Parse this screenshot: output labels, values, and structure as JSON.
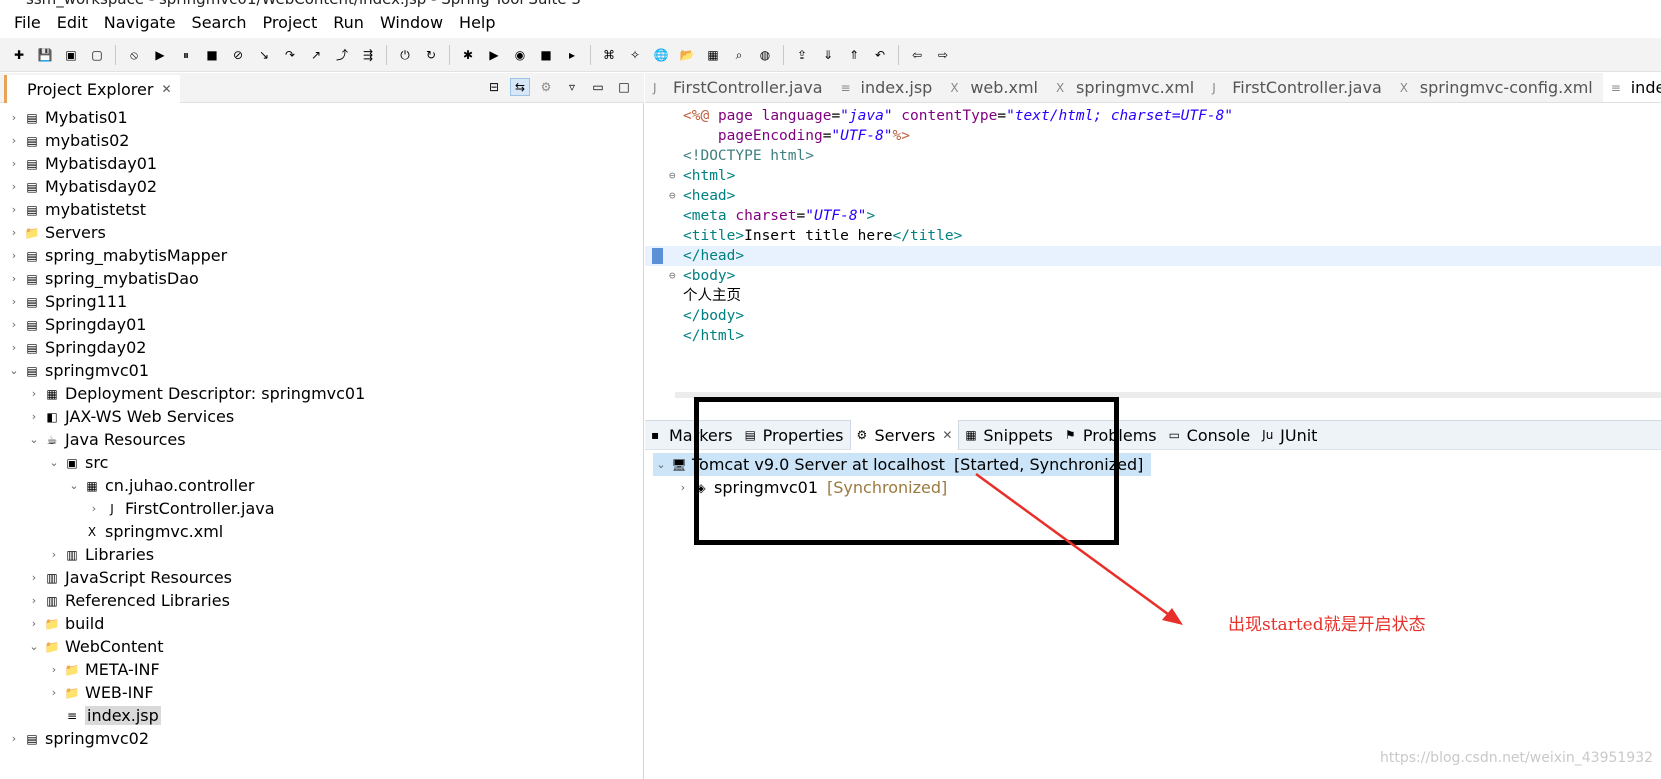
{
  "window": {
    "title": "ssm_workspace - springmvc01/WebContent/index.jsp - Spring Tool Suite 3"
  },
  "menubar": [
    "File",
    "Edit",
    "Navigate",
    "Search",
    "Project",
    "Run",
    "Window",
    "Help"
  ],
  "toolbar": {
    "icons": [
      "new-icon",
      "save-icon",
      "save-all-icon",
      "terminal-icon",
      "skip-breakpoints-icon",
      "resume-icon",
      "suspend-icon",
      "terminate-icon",
      "disconnect-icon",
      "step-into-icon",
      "step-over-icon",
      "step-return-icon",
      "drop-to-frame-icon",
      "use-step-filters-icon",
      "start-server-icon",
      "refresh-icon",
      "debug-icon",
      "run-icon",
      "coverage-icon",
      "stop-icon",
      "external-tools-icon",
      "open-type-icon",
      "new-spring-icon",
      "web-browser-icon",
      "open-folder-icon",
      "open-task-icon",
      "search-icon",
      "globe-icon",
      "deploy-icon",
      "next-annotation-icon",
      "previous-annotation-icon",
      "last-edit-icon",
      "back-icon",
      "forward-icon"
    ]
  },
  "explorer": {
    "title": "Project Explorer",
    "tree": [
      {
        "label": "Mybatis01",
        "icon": "project-icon",
        "depth": 0,
        "arrow": "collapsed"
      },
      {
        "label": "mybatis02",
        "icon": "project-icon",
        "depth": 0,
        "arrow": "collapsed"
      },
      {
        "label": "Mybatisday01",
        "icon": "project-icon",
        "depth": 0,
        "arrow": "collapsed"
      },
      {
        "label": "Mybatisday02",
        "icon": "project-icon",
        "depth": 0,
        "arrow": "collapsed"
      },
      {
        "label": "mybatistetst",
        "icon": "project-icon",
        "depth": 0,
        "arrow": "collapsed"
      },
      {
        "label": "Servers",
        "icon": "folder-icon",
        "depth": 0,
        "arrow": "collapsed"
      },
      {
        "label": "spring_mabytisMapper",
        "icon": "project-icon",
        "depth": 0,
        "arrow": "collapsed"
      },
      {
        "label": "spring_mybatisDao",
        "icon": "project-icon",
        "depth": 0,
        "arrow": "collapsed"
      },
      {
        "label": "Spring111",
        "icon": "project-icon",
        "depth": 0,
        "arrow": "collapsed"
      },
      {
        "label": "Springday01",
        "icon": "project-icon",
        "depth": 0,
        "arrow": "collapsed"
      },
      {
        "label": "Springday02",
        "icon": "project-icon",
        "depth": 0,
        "arrow": "collapsed"
      },
      {
        "label": "springmvc01",
        "icon": "project-icon",
        "depth": 0,
        "arrow": "expanded"
      },
      {
        "label": "Deployment Descriptor: springmvc01",
        "icon": "descriptor-icon",
        "depth": 1,
        "arrow": "collapsed"
      },
      {
        "label": "JAX-WS Web Services",
        "icon": "web-services-icon",
        "depth": 1,
        "arrow": "collapsed"
      },
      {
        "label": "Java Resources",
        "icon": "java-resources-icon",
        "depth": 1,
        "arrow": "expanded"
      },
      {
        "label": "src",
        "icon": "source-folder-icon",
        "depth": 2,
        "arrow": "expanded"
      },
      {
        "label": "cn.juhao.controller",
        "icon": "package-icon",
        "depth": 3,
        "arrow": "expanded"
      },
      {
        "label": "FirstController.java",
        "icon": "java-file-icon",
        "depth": 4,
        "arrow": "collapsed"
      },
      {
        "label": "springmvc.xml",
        "icon": "xml-file-icon",
        "depth": 3,
        "arrow": "none"
      },
      {
        "label": "Libraries",
        "icon": "library-icon",
        "depth": 2,
        "arrow": "collapsed"
      },
      {
        "label": "JavaScript Resources",
        "icon": "library-icon",
        "depth": 1,
        "arrow": "collapsed"
      },
      {
        "label": "Referenced Libraries",
        "icon": "library-icon",
        "depth": 1,
        "arrow": "collapsed"
      },
      {
        "label": "build",
        "icon": "folder-icon",
        "depth": 1,
        "arrow": "collapsed"
      },
      {
        "label": "WebContent",
        "icon": "folder-icon",
        "depth": 1,
        "arrow": "expanded"
      },
      {
        "label": "META-INF",
        "icon": "folder-icon",
        "depth": 2,
        "arrow": "collapsed"
      },
      {
        "label": "WEB-INF",
        "icon": "folder-icon",
        "depth": 2,
        "arrow": "collapsed"
      },
      {
        "label": "index.jsp",
        "icon": "jsp-file-icon",
        "depth": 2,
        "arrow": "none",
        "selected": true
      },
      {
        "label": "springmvc02",
        "icon": "project-icon",
        "depth": 0,
        "arrow": "collapsed"
      }
    ]
  },
  "editor": {
    "tabs": [
      {
        "label": "FirstController.java",
        "icon": "java-file-icon"
      },
      {
        "label": "index.jsp",
        "icon": "jsp-file-icon"
      },
      {
        "label": "web.xml",
        "icon": "xml-file-icon"
      },
      {
        "label": "springmvc.xml",
        "icon": "xml-file-icon"
      },
      {
        "label": "FirstController.java",
        "icon": "java-file-icon"
      },
      {
        "label": "springmvc-config.xml",
        "icon": "xml-file-icon"
      },
      {
        "label": "inde",
        "icon": "jsp-file-icon",
        "active": true
      }
    ],
    "body_text": "个人主页"
  },
  "bottom_panel": {
    "tabs": [
      {
        "label": "Markers",
        "icon": "markers-icon"
      },
      {
        "label": "Properties",
        "icon": "properties-icon"
      },
      {
        "label": "Servers",
        "icon": "servers-icon",
        "active": true
      },
      {
        "label": "Snippets",
        "icon": "snippets-icon"
      },
      {
        "label": "Problems",
        "icon": "problems-icon"
      },
      {
        "label": "Console",
        "icon": "console-icon"
      },
      {
        "label": "JUnit",
        "icon": "junit-icon"
      }
    ],
    "server": {
      "name": "Tomcat v9.0 Server at localhost",
      "status": "[Started, Synchronized]"
    },
    "module": {
      "name": "springmvc01",
      "status": "[Synchronized]"
    }
  },
  "annotation": {
    "text": "出现started就是开启状态",
    "color": "#e8302a"
  },
  "watermark": "https://blog.csdn.net/weixin_43951932",
  "colors": {
    "accent": "#e8a25a",
    "selection": "#cce4f7",
    "line_highlight": "#e8f2fe"
  }
}
